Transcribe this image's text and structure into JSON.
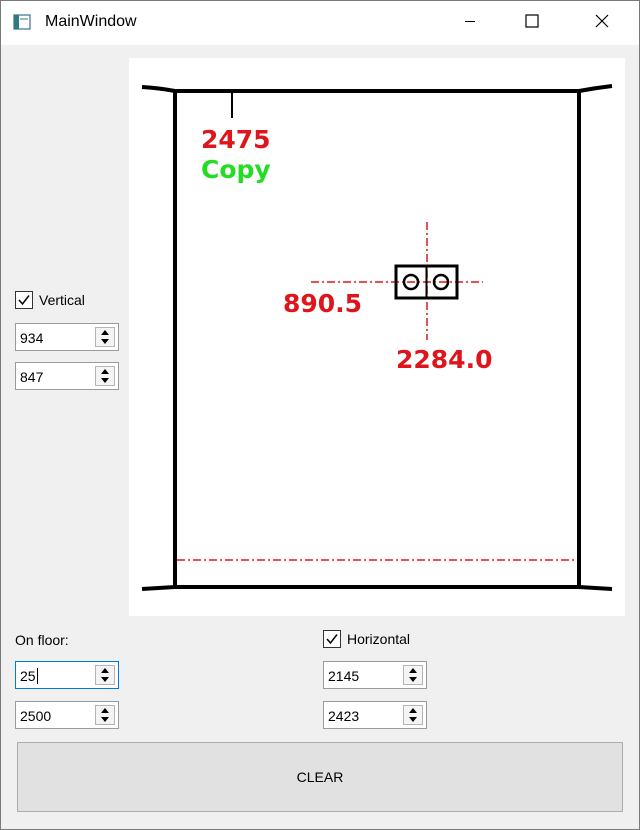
{
  "window": {
    "title": "MainWindow",
    "icon": "app-window-icon",
    "controls": [
      "minimize-icon",
      "maximize-icon",
      "close-icon"
    ]
  },
  "canvas": {
    "top_value": "2475",
    "top_caption": "Copy",
    "horizontal_dim": "890.5",
    "vertical_dim": "2284.0",
    "colors": {
      "frame": "#000000",
      "dimension": "#e0151b",
      "caption": "#22dd22",
      "centerline": "#e0151b"
    }
  },
  "vertical": {
    "label": "Vertical",
    "checked": true,
    "value1": "934",
    "value2": "847"
  },
  "on_floor": {
    "label": "On floor:",
    "value1": "25",
    "value2": "2500"
  },
  "horizontal": {
    "label": "Horizontal",
    "checked": true,
    "value1": "2145",
    "value2": "2423"
  },
  "clear_button": {
    "label": "CLEAR"
  }
}
